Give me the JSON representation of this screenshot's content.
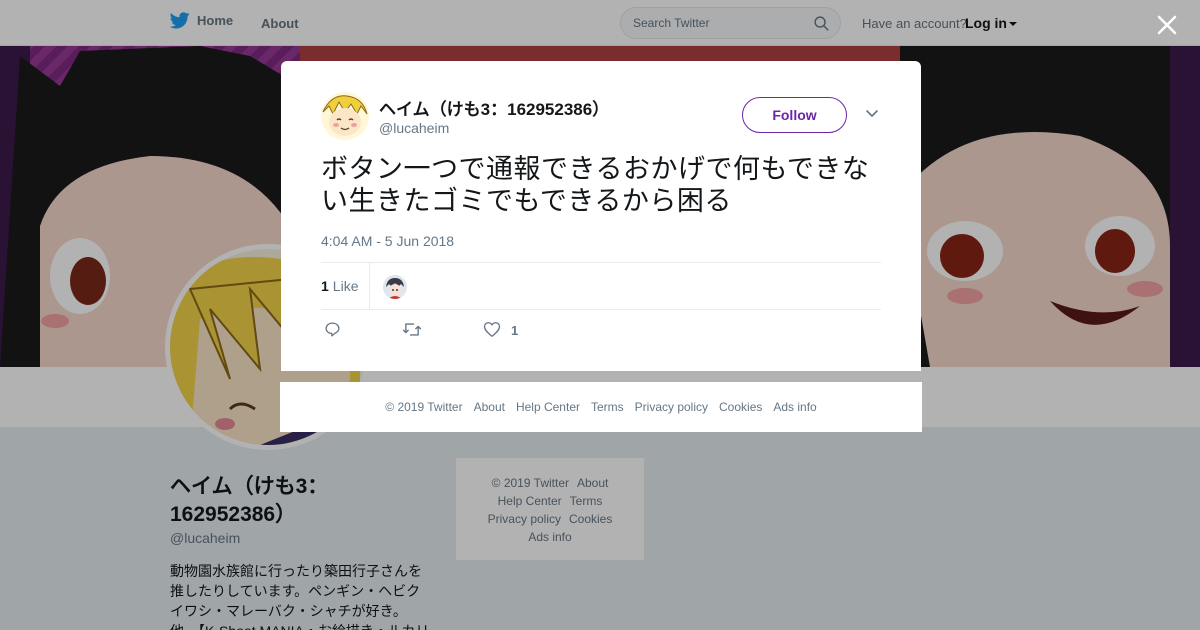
{
  "nav": {
    "home_label": "Home",
    "about_label": "About",
    "search_placeholder": "Search Twitter",
    "have_account": "Have an account?",
    "login_label": "Log in"
  },
  "profile": {
    "name": "ヘイム（けも3：162952386）",
    "handle": "@lucaheim",
    "bio": "動物園水族館に行ったり築田行子さんを推したりしています。ペンギン・ヘビクイワシ・マレーバク・シャチが好き。他、【K-Shoot MANIA・お絵描き・ルカリ"
  },
  "side_footer": {
    "links": [
      "© 2019 Twitter",
      "About",
      "Help Center",
      "Terms",
      "Privacy policy",
      "Cookies",
      "Ads info"
    ]
  },
  "tweet": {
    "author_name": "ヘイム（けも3：162952386）",
    "author_handle": "@lucaheim",
    "follow_label": "Follow",
    "text": "ボタン一つで通報できるおかげで何もできない生きたゴミでもできるから困る",
    "timestamp": "4:04 AM - 5 Jun 2018",
    "likes_count": "1",
    "likes_label": "Like",
    "action_like_count": "1"
  },
  "modal_footer": {
    "links": [
      "© 2019 Twitter",
      "About",
      "Help Center",
      "Terms",
      "Privacy policy",
      "Cookies",
      "Ads info"
    ]
  },
  "colors": {
    "accent": "#6a26a8",
    "twitter_blue": "#1da1f2",
    "muted": "#657786"
  },
  "icons": [
    "twitter-bird-icon",
    "search-icon",
    "caret-down-icon",
    "close-icon",
    "chevron-down-icon",
    "reply-icon",
    "retweet-icon",
    "heart-icon"
  ]
}
